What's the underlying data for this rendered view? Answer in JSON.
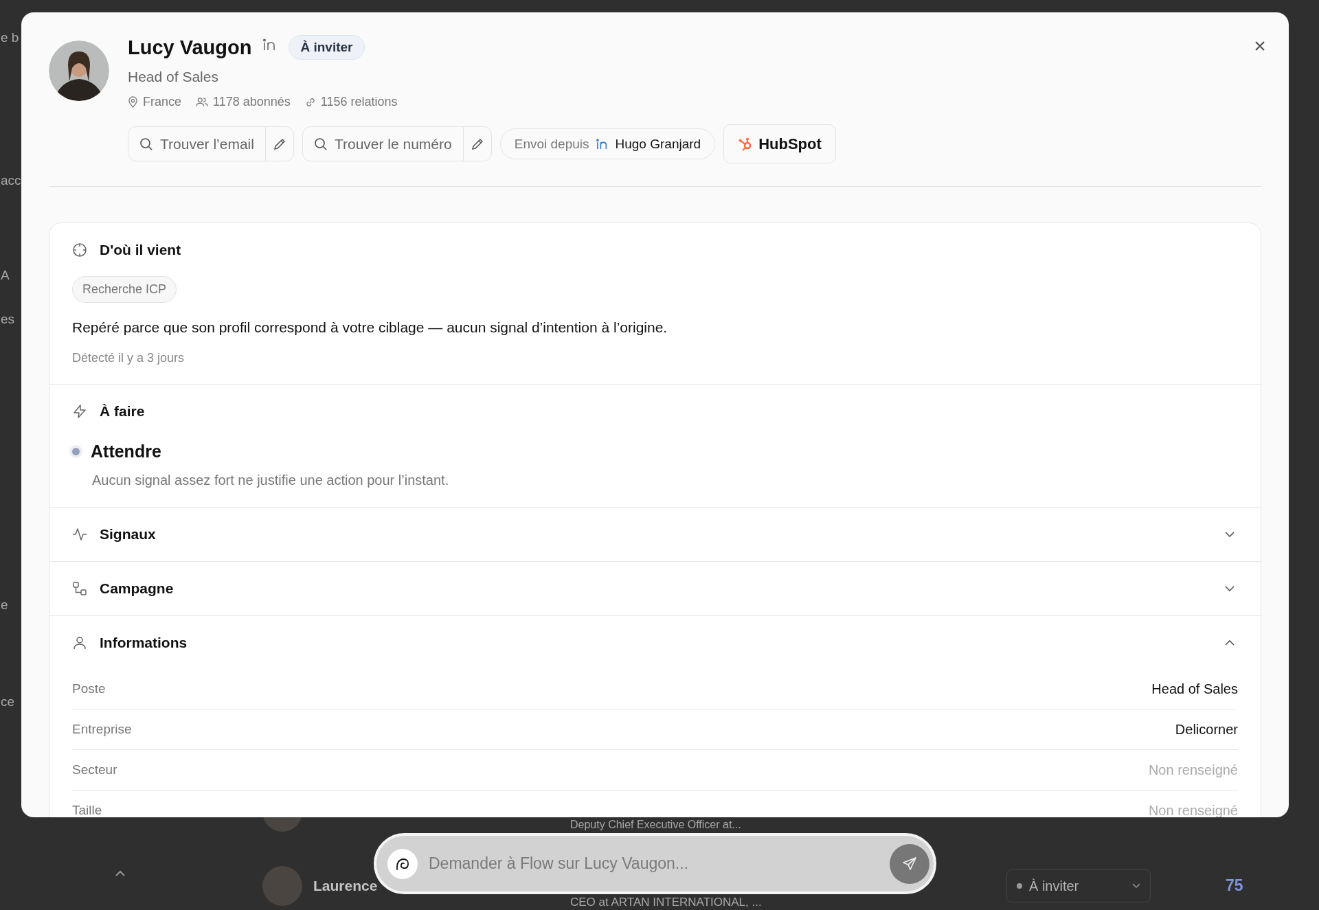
{
  "background": {
    "side_labels": [
      "e b",
      "acc",
      "A",
      "es",
      "e",
      "ce"
    ],
    "rows": [
      {
        "title": "Deputy Chief Executive Officer at..."
      },
      {
        "name": "Laurence",
        "title": "CEO at ARTAN INTERNATIONAL, ...",
        "status": "À inviter",
        "score": "75"
      }
    ]
  },
  "profile": {
    "name": "Lucy Vaugon",
    "linkedin": true,
    "badge": "À inviter",
    "headline": "Head of Sales",
    "location": "France",
    "followers": "1178 abonnés",
    "connections": "1156 relations"
  },
  "actions": [
    {
      "kind": "search",
      "label": "Trouver l’email"
    },
    {
      "kind": "search",
      "label": "Trouver le numéro"
    },
    {
      "kind": "sender",
      "label": "Envoi depuis",
      "value": "Hugo Granjard"
    },
    {
      "kind": "crm",
      "label": "HubSpot"
    }
  ],
  "sections": [
    {
      "kind": "origin",
      "title": "D'où il vient",
      "tag": "Recherche ICP",
      "text": "Repéré parce que son profil correspond à votre ciblage — aucun signal d’intention à l’origine.",
      "detected": "Détecté il y a 3 jours"
    },
    {
      "kind": "todo",
      "title": "À faire",
      "action": "Attendre",
      "description": "Aucun signal assez fort ne justifie une action pour l’instant."
    },
    {
      "kind": "signals",
      "title": "Signaux",
      "expanded": false
    },
    {
      "kind": "campaign",
      "title": "Campagne",
      "expanded": false
    },
    {
      "kind": "info",
      "title": "Informations",
      "expanded": true,
      "fields": [
        {
          "label": "Poste",
          "value": "Head of Sales",
          "filled": true
        },
        {
          "label": "Entreprise",
          "value": "Delicorner",
          "filled": true
        },
        {
          "label": "Secteur",
          "value": "Non renseigné",
          "filled": false
        },
        {
          "label": "Taille",
          "value": "Non renseigné",
          "filled": false
        }
      ]
    }
  ],
  "chat": {
    "placeholder": "Demander à Flow sur Lucy Vaugon..."
  }
}
